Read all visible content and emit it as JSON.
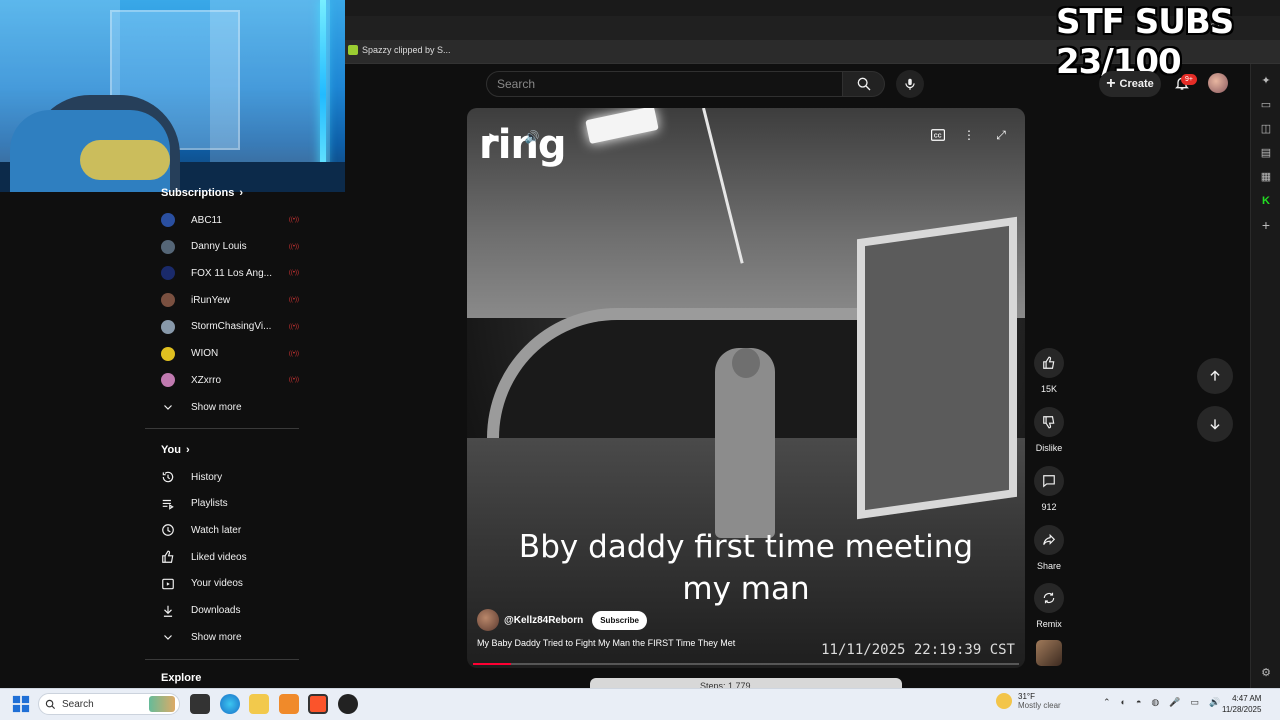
{
  "overlay": {
    "stream_banner": "STF SUBS 23/100"
  },
  "browser": {
    "bookmark_label": "Spazzy clipped by S...",
    "window_controls": [
      "–",
      "☐",
      "✕"
    ]
  },
  "masthead": {
    "search_placeholder": "Search",
    "create_label": "Create",
    "notification_count": "9+"
  },
  "sidebar": {
    "subscriptions_header": "Subscriptions",
    "subscriptions": [
      {
        "name": "ABC11",
        "color": "#2a4fa0"
      },
      {
        "name": "Danny Louis",
        "color": "#556677"
      },
      {
        "name": "FOX 11 Los Ang...",
        "color": "#1a2a6a"
      },
      {
        "name": "iRunYew",
        "color": "#7a5040"
      },
      {
        "name": "StormChasingVi...",
        "color": "#8899aa"
      },
      {
        "name": "WION",
        "color": "#e0c020"
      },
      {
        "name": "XZxrro",
        "color": "#c07ab0"
      }
    ],
    "show_more_subs": "Show more",
    "you_header": "You",
    "you_items": [
      {
        "label": "History",
        "icon": "history-icon"
      },
      {
        "label": "Playlists",
        "icon": "playlists-icon"
      },
      {
        "label": "Watch later",
        "icon": "watch-later-icon"
      },
      {
        "label": "Liked videos",
        "icon": "liked-icon"
      },
      {
        "label": "Your videos",
        "icon": "your-videos-icon"
      },
      {
        "label": "Downloads",
        "icon": "downloads-icon"
      }
    ],
    "show_more_you": "Show more",
    "explore_header": "Explore"
  },
  "video": {
    "caption_line1": "Bby daddy first time meeting",
    "caption_line2": "my man",
    "channel_handle": "@Kellz84Reborn",
    "subscribe_label": "Subscribe",
    "title": "My Baby Daddy Tried to Fight My Man the FIRST Time They Met",
    "timestamp": "11/11/2025 22:19:39 CST",
    "progress_fraction": 0.07,
    "watermark": "ring"
  },
  "actions": {
    "likes": "15K",
    "dislike_label": "Dislike",
    "comments": "912",
    "share_label": "Share",
    "remix_label": "Remix"
  },
  "next_preview": {
    "text": "Steps: 1,779"
  },
  "taskbar": {
    "search_label": "Search",
    "temperature": "31°F",
    "weather_desc": "Mostly clear",
    "time": "4:47 AM",
    "date": "11/28/2025"
  }
}
